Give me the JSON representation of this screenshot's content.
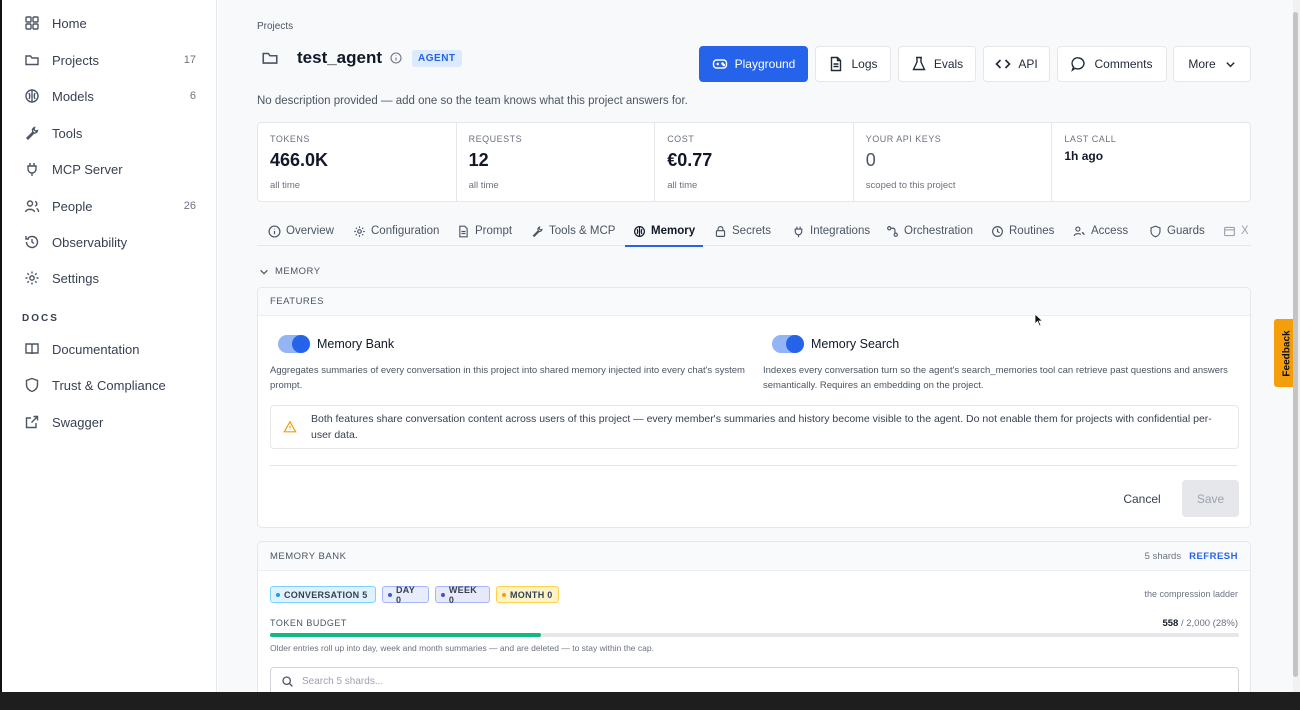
{
  "sidebar": {
    "items": [
      {
        "label": "Home",
        "icon": "home-grid-icon",
        "count": ""
      },
      {
        "label": "Projects",
        "icon": "folder-icon",
        "count": "17"
      },
      {
        "label": "Models",
        "icon": "brain-icon",
        "count": "6"
      },
      {
        "label": "Tools",
        "icon": "wrench-icon",
        "count": ""
      },
      {
        "label": "MCP Server",
        "icon": "plug-icon",
        "count": ""
      },
      {
        "label": "People",
        "icon": "people-icon",
        "count": "26"
      },
      {
        "label": "Observability",
        "icon": "history-icon",
        "count": ""
      },
      {
        "label": "Settings",
        "icon": "gear-icon",
        "count": ""
      }
    ],
    "docs_heading": "DOCS",
    "docs": [
      {
        "label": "Documentation",
        "icon": "book-icon"
      },
      {
        "label": "Trust & Compliance",
        "icon": "shield-icon"
      },
      {
        "label": "Swagger",
        "icon": "external-link-icon"
      }
    ]
  },
  "header": {
    "breadcrumb": "Projects",
    "title": "test_agent",
    "badge": "AGENT",
    "description": "No description provided — add one so the team knows what this project answers for.",
    "buttons": {
      "playground": "Playground",
      "logs": "Logs",
      "evals": "Evals",
      "api": "API",
      "comments": "Comments",
      "more": "More"
    }
  },
  "stats": [
    {
      "label": "TOKENS",
      "value": "466.0K",
      "sub": "all time"
    },
    {
      "label": "REQUESTS",
      "value": "12",
      "sub": "all time"
    },
    {
      "label": "COST",
      "value": "€0.77",
      "sub": "all time"
    },
    {
      "label": "YOUR API KEYS",
      "value": "0",
      "sub": "scoped to this project"
    },
    {
      "label": "LAST CALL",
      "value": "1h ago",
      "sub": ""
    }
  ],
  "tabs": [
    {
      "label": "Overview"
    },
    {
      "label": "Configuration"
    },
    {
      "label": "Prompt"
    },
    {
      "label": "Tools & MCP"
    },
    {
      "label": "Memory"
    },
    {
      "label": "Secrets"
    },
    {
      "label": "Integrations"
    },
    {
      "label": "Orchestration"
    },
    {
      "label": "Routines"
    },
    {
      "label": "Access"
    },
    {
      "label": "Guards"
    },
    {
      "label": "X"
    }
  ],
  "active_tab": "Memory",
  "memory": {
    "section_label": "MEMORY",
    "features_label": "FEATURES",
    "memory_bank": {
      "label": "Memory Bank",
      "enabled": true,
      "description": "Aggregates summaries of every conversation in this project into shared memory injected into every chat's system prompt."
    },
    "memory_search": {
      "label": "Memory Search",
      "enabled": true,
      "description": "Indexes every conversation turn so the agent's search_memories tool can retrieve past questions and answers semantically. Requires an embedding on the project."
    },
    "warning": "Both features share conversation content across users of this project — every member's summaries and history become visible to the agent. Do not enable them for projects with confidential per-user data.",
    "cancel_label": "Cancel",
    "save_label": "Save"
  },
  "memory_bank_panel": {
    "heading": "MEMORY BANK",
    "shards": "5 shards",
    "refresh_label": "REFRESH",
    "pills": [
      {
        "label": "CONVERSATION 5",
        "color": "#0ea5e9"
      },
      {
        "label": "DAY 0",
        "color": "#3b5bdb"
      },
      {
        "label": "WEEK 0",
        "color": "#4c51bf"
      },
      {
        "label": "MONTH 0",
        "color": "#f59e0b"
      }
    ],
    "ladder_label": "the compression ladder",
    "token_budget_label": "TOKEN BUDGET",
    "token_used": "558",
    "token_rest": " / 2,000 (28%)",
    "token_fraction": 0.28,
    "token_note": "Older entries roll up into day, week and month summaries — and are deleted — to stay within the cap.",
    "search_placeholder": "Search 5 shards..."
  },
  "feedback_label": "Feedback",
  "colors": {
    "accent": "#2563eb",
    "progress": "#10b981",
    "warning": "#f59e0b"
  }
}
